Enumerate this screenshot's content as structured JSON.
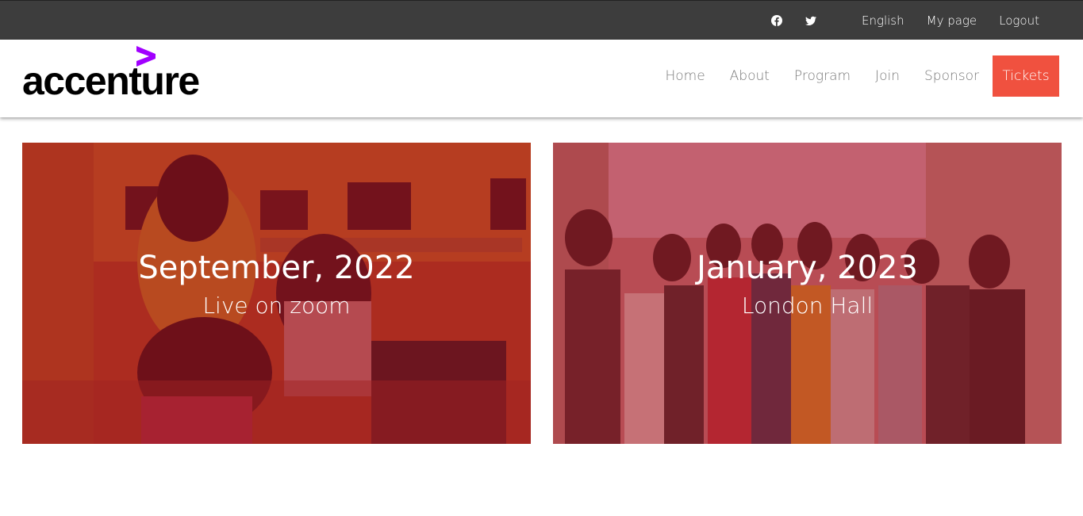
{
  "topbar": {
    "social": [
      {
        "icon": "facebook-icon"
      },
      {
        "icon": "twitter-icon"
      }
    ],
    "links": [
      "English",
      "My page",
      "Logout"
    ]
  },
  "logo": {
    "text": "accenture",
    "accent_color": "#a100ff"
  },
  "nav": {
    "items": [
      "Home",
      "About",
      "Program",
      "Join",
      "Sponsor"
    ],
    "cta": "Tickets",
    "cta_color": "#f0513f"
  },
  "events": [
    {
      "date": "September, 2022",
      "location": "Live on zoom"
    },
    {
      "date": "January, 2023",
      "location": "London Hall"
    }
  ]
}
